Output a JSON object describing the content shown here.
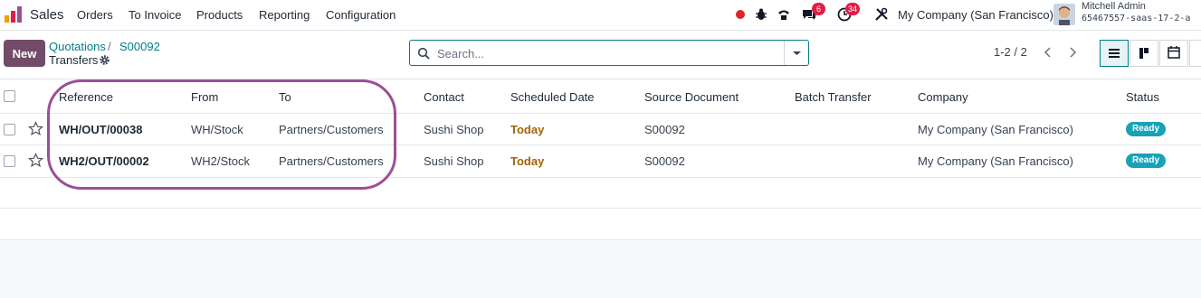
{
  "topbar": {
    "app_name": "Sales",
    "menu": [
      "Orders",
      "To Invoice",
      "Products",
      "Reporting",
      "Configuration"
    ],
    "icons": [
      "record-icon",
      "bug-icon",
      "phone-icon",
      "chat-icon",
      "clock-icon",
      "tools-icon"
    ],
    "chat_badge": "6",
    "activity_badge": "34",
    "company": "My Company (San Francisco)",
    "user_name": "Mitchell Admin",
    "database": "65467557-saas-17-2-a"
  },
  "control": {
    "new_label": "New",
    "breadcrumb": [
      "Quotations",
      "S00092"
    ],
    "current": "Transfers",
    "search_placeholder": "Search...",
    "pager": "1-2 / 2"
  },
  "table": {
    "columns": [
      "Reference",
      "From",
      "To",
      "Contact",
      "Scheduled Date",
      "Source Document",
      "Batch Transfer",
      "Company",
      "Status"
    ],
    "rows": [
      {
        "reference": "WH/OUT/00038",
        "from": "WH/Stock",
        "to": "Partners/Customers",
        "contact": "Sushi Shop",
        "scheduled": "Today",
        "source": "S00092",
        "batch": "",
        "company": "My Company (San Francisco)",
        "status": "Ready"
      },
      {
        "reference": "WH2/OUT/00002",
        "from": "WH2/Stock",
        "to": "Partners/Customers",
        "contact": "Sushi Shop",
        "scheduled": "Today",
        "source": "S00092",
        "batch": "",
        "company": "My Company (San Francisco)",
        "status": "Ready"
      }
    ]
  },
  "colors": {
    "brand": "#714b67",
    "link": "#017e84",
    "status_ready": "#17a2b8",
    "today": "#a16207",
    "highlight": "#9b4f96"
  }
}
